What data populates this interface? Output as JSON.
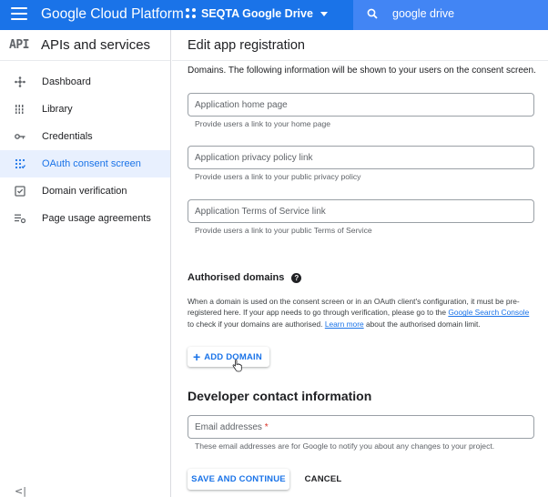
{
  "topbar": {
    "brand": "Google Cloud Platform",
    "project_name": "SEQTA Google Drive",
    "search_value": "google drive",
    "accent_color": "#1a73e8"
  },
  "sidebar": {
    "logo_text": "API",
    "title": "APIs and services",
    "items": [
      {
        "label": "Dashboard",
        "icon": "dashboard-icon",
        "active": false
      },
      {
        "label": "Library",
        "icon": "library-icon",
        "active": false
      },
      {
        "label": "Credentials",
        "icon": "key-icon",
        "active": false
      },
      {
        "label": "OAuth consent screen",
        "icon": "consent-icon",
        "active": true
      },
      {
        "label": "Domain verification",
        "icon": "checkbox-icon",
        "active": false
      },
      {
        "label": "Page usage agreements",
        "icon": "settings-list-icon",
        "active": false
      }
    ],
    "collapse_label": "<|"
  },
  "main": {
    "title": "Edit app registration",
    "intro": "Domains. The following information will be shown to your users on the consent screen.",
    "fields": [
      {
        "placeholder": "Application home page",
        "hint": "Provide users a link to your home page"
      },
      {
        "placeholder": "Application privacy policy link",
        "hint": "Provide users a link to your public privacy policy"
      },
      {
        "placeholder": "Application Terms of Service link",
        "hint": "Provide users a link to your public Terms of Service"
      }
    ],
    "authorised": {
      "title": "Authorised domains",
      "para_1": "When a domain is used on the consent screen or in an OAuth client's configuration, it must be pre-registered here. If your app needs to go through verification, please go to the ",
      "link_console": "Google Search Console",
      "para_2": " to check if your domains are authorised. ",
      "link_learn": "Learn more",
      "para_3": " about the authorised domain limit.",
      "add_button": "ADD DOMAIN"
    },
    "developer": {
      "title": "Developer contact information",
      "email_placeholder": "Email addresses",
      "required_mark": "*",
      "hint": "These email addresses are for Google to notify you about any changes to your project."
    },
    "actions": {
      "save": "SAVE AND CONTINUE",
      "cancel": "CANCEL"
    }
  }
}
